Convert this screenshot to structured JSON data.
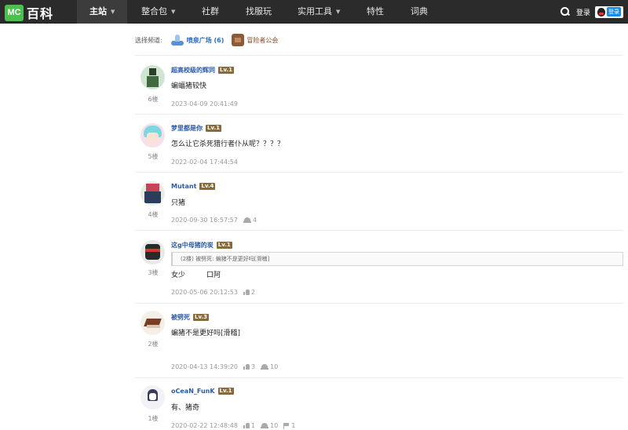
{
  "nav": {
    "logo_mc": "MC",
    "logo_text": "百科",
    "items": [
      {
        "label": "主站",
        "caret": true
      },
      {
        "label": "整合包",
        "caret": true
      },
      {
        "label": "社群",
        "caret": false
      },
      {
        "label": "找服玩",
        "caret": false
      },
      {
        "label": "实用工具",
        "caret": true
      },
      {
        "label": "特性",
        "caret": false
      },
      {
        "label": "词典",
        "caret": false
      }
    ],
    "login": "登录",
    "qq_login": "登录"
  },
  "channels": {
    "label": "选择频道:",
    "items": [
      {
        "name": "喷泉广场 (6)",
        "icon": "fountain-icon"
      },
      {
        "name": "冒险者公会",
        "icon": "guild-icon"
      }
    ]
  },
  "comments": [
    {
      "author": "超高校级的辉同",
      "level": "Lv.1",
      "floor": "6楼",
      "text": "蝙蝠猪较快",
      "quote": "",
      "time": "2023-04-09 20:41:49",
      "likes": "",
      "helmets": "",
      "flags": "",
      "avatar": "creeper"
    },
    {
      "author": "梦里都是你",
      "level": "Lv.1",
      "floor": "5楼",
      "text": "怎么让它杀死猎行者仆从呢？？？？",
      "quote": "",
      "time": "2022-02-04 17:44:54",
      "likes": "",
      "helmets": "",
      "flags": "",
      "avatar": "anime"
    },
    {
      "author": "Mutant",
      "level": "Lv.4",
      "floor": "4楼",
      "text": "只猪",
      "quote": "",
      "time": "2020-09-30 16:57:57",
      "likes": "",
      "helmets": "4",
      "flags": "",
      "avatar": "mutant"
    },
    {
      "author": "这g中母猪的炭",
      "level": "Lv.1",
      "floor": "3楼",
      "text": "女少　　　口阿",
      "quote": "(2楼) 被劈死: 蝙猪不是更好吗[滑稽]",
      "time": "2020-05-06 20:12:53",
      "likes": "2",
      "helmets": "",
      "flags": "",
      "avatar": "ninja"
    },
    {
      "author": "被劈死",
      "level": "Lv.3",
      "floor": "2楼",
      "text": "蝙猪不是更好吗[滑稽]",
      "quote": "",
      "time": "2020-04-13 14:39:20",
      "likes": "3",
      "helmets": "10",
      "flags": "",
      "avatar": "cake"
    },
    {
      "author": "oCeaN_FunK",
      "level": "Lv.1",
      "floor": "1楼",
      "text": "有、猪奇",
      "quote": "",
      "time": "2020-02-22 12:48:48",
      "likes": "1",
      "helmets": "10",
      "flags": "1",
      "avatar": "sketch"
    }
  ]
}
